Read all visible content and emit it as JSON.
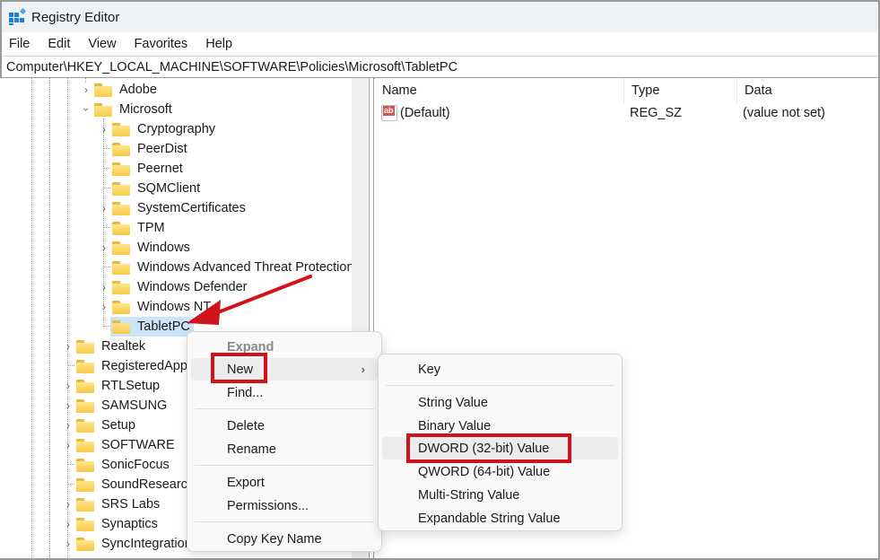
{
  "window": {
    "title": "Registry Editor",
    "app_icon": "registry-editor-icon"
  },
  "menubar": {
    "items": [
      "File",
      "Edit",
      "View",
      "Favorites",
      "Help"
    ]
  },
  "address": {
    "path": "Computer\\HKEY_LOCAL_MACHINE\\SOFTWARE\\Policies\\Microsoft\\TabletPC"
  },
  "tree": {
    "items": [
      {
        "label": "Adobe",
        "expander": "collapsed",
        "level": 2
      },
      {
        "label": "Microsoft",
        "expander": "expanded",
        "level": 2
      },
      {
        "label": "Cryptography",
        "expander": "collapsed",
        "level": 3
      },
      {
        "label": "PeerDist",
        "expander": "none",
        "level": 3
      },
      {
        "label": "Peernet",
        "expander": "none",
        "level": 3
      },
      {
        "label": "SQMClient",
        "expander": "none",
        "level": 3
      },
      {
        "label": "SystemCertificates",
        "expander": "collapsed",
        "level": 3
      },
      {
        "label": "TPM",
        "expander": "none",
        "level": 3
      },
      {
        "label": "Windows",
        "expander": "collapsed",
        "level": 3
      },
      {
        "label": "Windows Advanced Threat Protection",
        "expander": "none",
        "level": 3
      },
      {
        "label": "Windows Defender",
        "expander": "collapsed",
        "level": 3
      },
      {
        "label": "Windows NT",
        "expander": "collapsed",
        "level": 3
      },
      {
        "label": "TabletPC",
        "expander": "none",
        "level": 3,
        "selected": true
      },
      {
        "label": "Realtek",
        "expander": "collapsed",
        "level": 1
      },
      {
        "label": "RegisteredApplications",
        "expander": "none",
        "level": 1
      },
      {
        "label": "RTLSetup",
        "expander": "collapsed",
        "level": 1
      },
      {
        "label": "SAMSUNG",
        "expander": "collapsed",
        "level": 1
      },
      {
        "label": "Setup",
        "expander": "collapsed",
        "level": 1
      },
      {
        "label": "SOFTWARE",
        "expander": "collapsed",
        "level": 1
      },
      {
        "label": "SonicFocus",
        "expander": "none",
        "level": 1
      },
      {
        "label": "SoundResearch",
        "expander": "none",
        "level": 1
      },
      {
        "label": "SRS Labs",
        "expander": "collapsed",
        "level": 1
      },
      {
        "label": "Synaptics",
        "expander": "collapsed",
        "level": 1
      },
      {
        "label": "SyncIntegration",
        "expander": "collapsed",
        "level": 1
      }
    ]
  },
  "values_pane": {
    "columns": [
      "Name",
      "Type",
      "Data"
    ],
    "rows": [
      {
        "name": "(Default)",
        "type": "REG_SZ",
        "data": "(value not set)",
        "icon": "string-value-icon"
      }
    ]
  },
  "context_menu": {
    "items": [
      {
        "label": "Expand",
        "disabled": true
      },
      {
        "label": "New",
        "submenu": true,
        "highlighted": true
      },
      {
        "label": "Find..."
      },
      {
        "separator": true
      },
      {
        "label": "Delete"
      },
      {
        "label": "Rename"
      },
      {
        "separator": true
      },
      {
        "label": "Export"
      },
      {
        "label": "Permissions..."
      },
      {
        "separator": true
      },
      {
        "label": "Copy Key Name"
      }
    ]
  },
  "submenu_new": {
    "items": [
      {
        "label": "Key"
      },
      {
        "separator": true
      },
      {
        "label": "String Value"
      },
      {
        "label": "Binary Value"
      },
      {
        "label": "DWORD (32-bit) Value",
        "highlighted": true
      },
      {
        "label": "QWORD (64-bit) Value"
      },
      {
        "label": "Multi-String Value"
      },
      {
        "label": "Expandable String Value"
      }
    ]
  },
  "annotations": {
    "highlight_color": "#d0131a",
    "arrow_color": "#d0131a"
  }
}
